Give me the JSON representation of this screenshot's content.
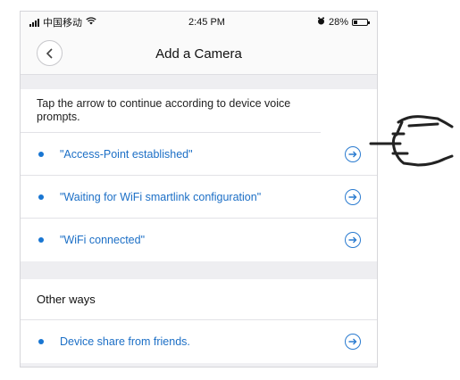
{
  "status_bar": {
    "carrier": "中国移动",
    "time": "2:45 PM",
    "battery": "28%",
    "battery_level": 0.28
  },
  "header": {
    "title": "Add a Camera",
    "back_icon": "chevron-left-icon"
  },
  "main": {
    "hint": "Tap the arrow to continue according to device voice prompts.",
    "prompts": [
      {
        "label": "\"Access-Point established\""
      },
      {
        "label": "\"Waiting for WiFi smartlink configuration\""
      },
      {
        "label": "\"WiFi connected\""
      }
    ],
    "other_ways": {
      "heading": "Other ways",
      "items": [
        {
          "label": "Device share from friends."
        }
      ]
    }
  },
  "icons": {
    "row_arrow": "arrow-right-circle-icon",
    "pointer": "pointing-hand-icon"
  },
  "colors": {
    "accent": "#1c6fc6",
    "background": "#f0f0f3"
  }
}
